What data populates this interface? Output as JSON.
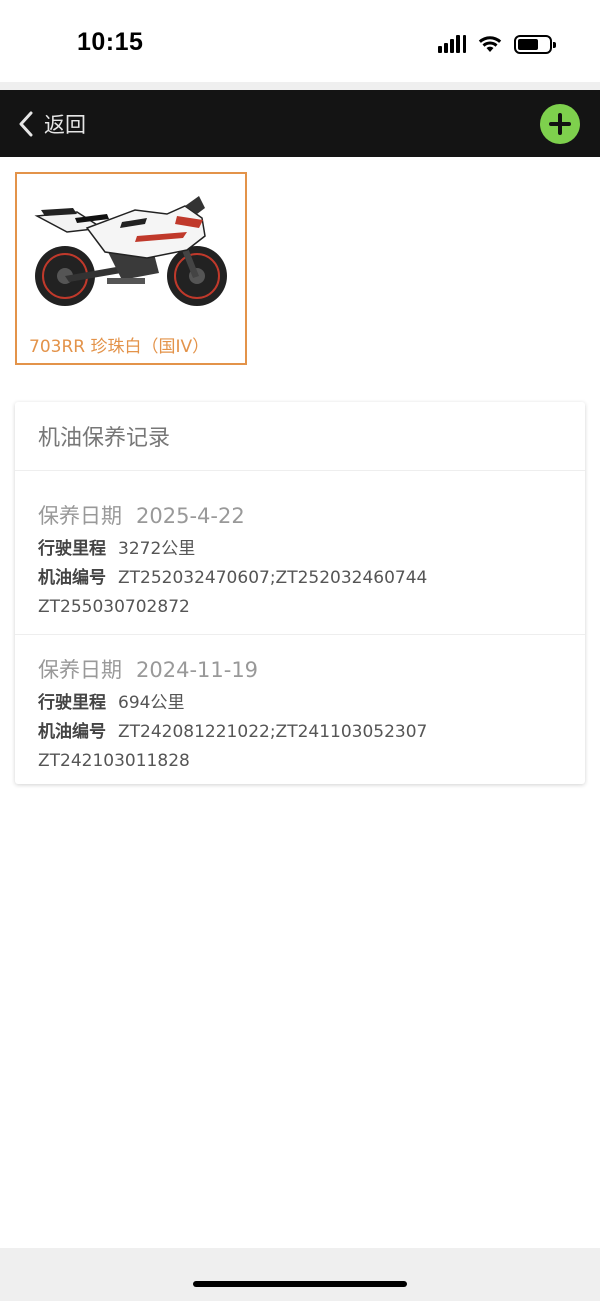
{
  "status_bar": {
    "time": "10:15",
    "icons": [
      "signal-icon",
      "wifi-icon",
      "battery-icon"
    ]
  },
  "nav": {
    "back_label": "返回",
    "back_icon": "chevron-left-icon",
    "add_icon": "plus-circle-icon",
    "add_color": "#7ed04d",
    "bar_color": "#141414"
  },
  "vehicle": {
    "name": "703RR 珍珠白（国IV）",
    "image": "motorcycle-image",
    "accent_color": "#e3934a"
  },
  "maintenance": {
    "title": "机油保养记录",
    "records": [
      {
        "date_label": "保养日期",
        "date": "2025-4-22",
        "mileage_label": "行驶里程",
        "mileage": "3272公里",
        "oil_label": "机油编号",
        "oil_codes_line1": "ZT252032470607;ZT252032460744",
        "oil_codes_line2": "ZT255030702872"
      },
      {
        "date_label": "保养日期",
        "date": "2024-11-19",
        "mileage_label": "行驶里程",
        "mileage": "694公里",
        "oil_label": "机油编号",
        "oil_codes_line1": "ZT242081221022;ZT241103052307",
        "oil_codes_line2": "ZT242103011828"
      }
    ]
  }
}
